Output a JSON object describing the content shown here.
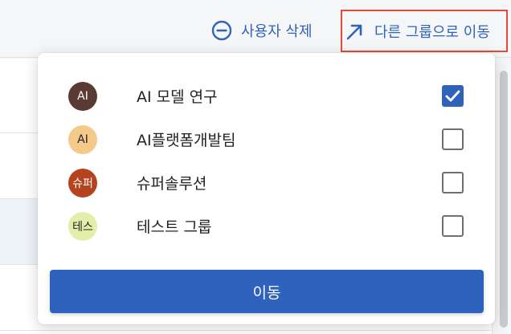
{
  "toolbar": {
    "delete_label": "사용자 삭제",
    "move_label": "다른 그룹으로 이동"
  },
  "groups": [
    {
      "avatar": "AI",
      "name": "AI 모델 연구",
      "checked": true,
      "avatar_bg": "#5b3a33",
      "avatar_fg": "#ffffff"
    },
    {
      "avatar": "AI",
      "name": "AI플랫폼개발팀",
      "checked": false,
      "avatar_bg": "#f5c98a",
      "avatar_fg": "#222222"
    },
    {
      "avatar": "슈퍼",
      "name": "슈퍼솔루션",
      "checked": false,
      "avatar_bg": "#b4431f",
      "avatar_fg": "#ffffff"
    },
    {
      "avatar": "테스",
      "name": "테스트 그룹",
      "checked": false,
      "avatar_bg": "#e2efaa",
      "avatar_fg": "#222222"
    }
  ],
  "move_button_label": "이동",
  "colors": {
    "accent": "#2f63b9",
    "highlight_border": "#e5493a"
  }
}
